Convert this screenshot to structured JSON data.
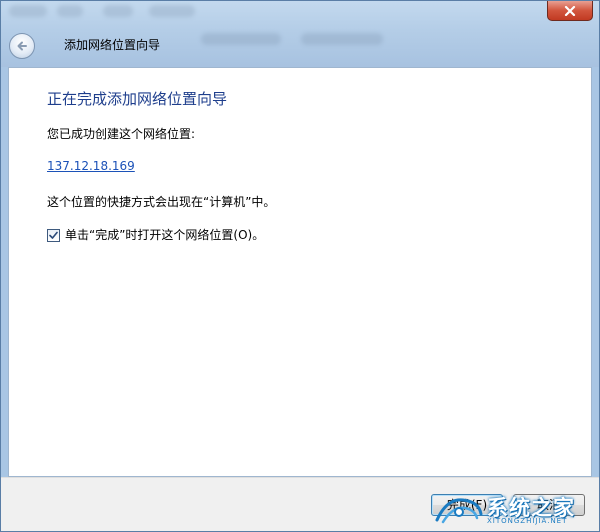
{
  "window": {
    "title": "添加网络位置向导"
  },
  "content": {
    "heading": "正在完成添加网络位置向导",
    "created_text": "您已成功创建这个网络位置:",
    "location_link": "137.12.18.169",
    "shortcut_text": "这个位置的快捷方式会出现在“计算机”中。",
    "open_checkbox": {
      "label": "单击“完成”时打开这个网络位置(O)。",
      "checked": true
    }
  },
  "footer": {
    "finish_label": "完成(F)",
    "cancel_label": "取消"
  },
  "watermark": {
    "text": "系统之家",
    "subtext": "XITONGZHIJIA.NET"
  },
  "icons": {
    "close": "close-icon",
    "back": "back-arrow-icon",
    "check": "checkmark-icon"
  },
  "colors": {
    "heading": "#1e3e8c",
    "link": "#1c52b8",
    "close_button": "#c13a22",
    "titlebar": "#b4cde7"
  }
}
